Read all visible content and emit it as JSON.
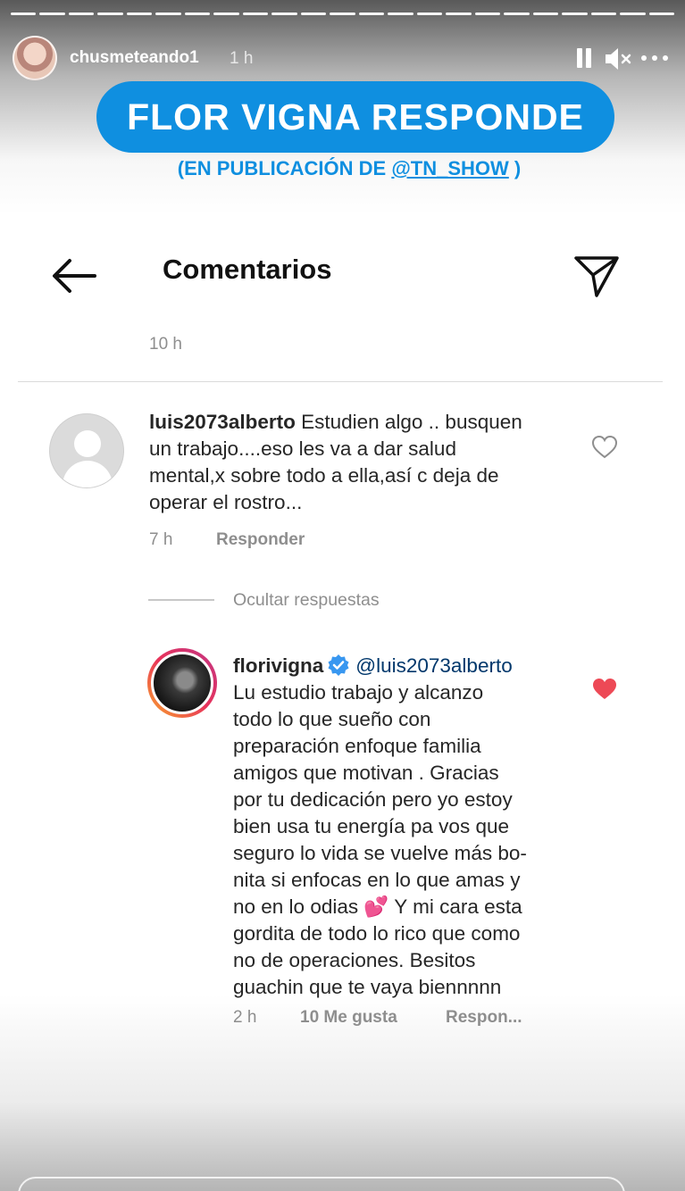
{
  "story": {
    "username": "chusmeteando1",
    "time_ago": "1 h",
    "progress_segments": 23,
    "active_segments": 23
  },
  "banner": {
    "title": "FLOR VIGNA RESPONDE",
    "subtitle_prefix": "(EN PUBLICACIÓN DE ",
    "subtitle_handle": "@TN_SHOW",
    "subtitle_suffix": " )"
  },
  "screen": {
    "title": "Comentarios",
    "post_time": "10 h"
  },
  "comments": [
    {
      "username": "luis2073alberto",
      "text": " Estudien algo .. busquen\nun trabajo....eso les va a dar salud\nmental,x sobre todo a ella,así c deja de\noperar el rostro...",
      "time": "7 h",
      "reply_label": "Responder",
      "liked": false
    }
  ],
  "hide_replies_label": "Ocultar respuestas",
  "replies": [
    {
      "username": "florivigna",
      "verified": true,
      "mention": "@luis2073alberto",
      "text": "Lu estudio trabajo y alcanzo\ntodo lo que sueño con\npreparación enfoque familia\namigos que motivan . Gracias\npor tu dedicación pero yo estoy\nbien usa tu energía pa vos que\nseguro lo vida se vuelve más bo-\nnita si enfocas en lo que amas y\nno en lo odias 💕 Y mi cara esta\ngordita de todo lo rico que como\nno de operaciones. Besitos\nguachin que te vaya  biennnnn",
      "time": "2 h",
      "likes_label": "10 Me gusta",
      "reply_label": "Respon...",
      "liked": true
    }
  ],
  "colors": {
    "banner_blue": "#0f8fe0",
    "like_red": "#ed4956",
    "verified_blue": "#3897f0",
    "meta_gray": "#8e8e8e"
  },
  "icons": [
    "back-arrow-icon",
    "send-icon",
    "heart-outline-icon",
    "heart-filled-icon",
    "verified-badge-icon",
    "pause-icon",
    "mute-icon",
    "more-icon"
  ]
}
